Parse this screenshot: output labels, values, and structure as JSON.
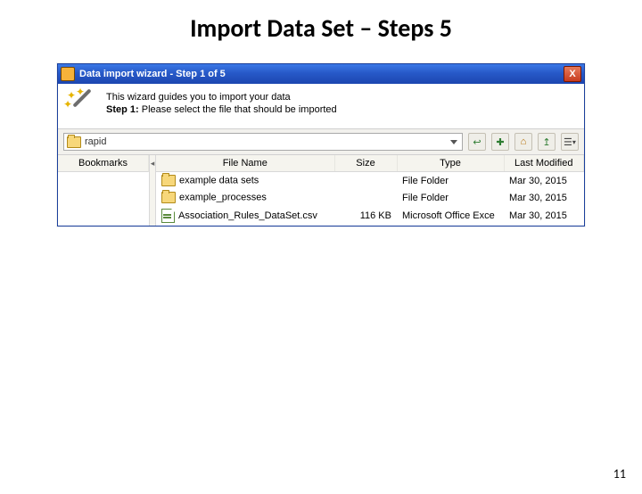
{
  "slide": {
    "title": "Import Data Set – Steps 5",
    "page_number": "11"
  },
  "window": {
    "title": "Data import wizard - Step 1 of 5",
    "wizard_intro": "This wizard guides you to import your data",
    "step_label": "Step 1:",
    "step_text": " Please select the file that should be imported",
    "path_value": "rapid",
    "toolbar_icons": [
      "back-icon",
      "new-folder-icon",
      "home-icon",
      "up-icon",
      "view-icon"
    ],
    "columns": {
      "bookmarks": "Bookmarks",
      "filename": "File Name",
      "size": "Size",
      "type": "Type",
      "modified": "Last Modified"
    },
    "rows": [
      {
        "icon": "folder",
        "name": "example data sets",
        "size": "",
        "type": "File Folder",
        "modified": "Mar 30, 2015"
      },
      {
        "icon": "folder",
        "name": "example_processes",
        "size": "",
        "type": "File Folder",
        "modified": "Mar 30, 2015"
      },
      {
        "icon": "file",
        "name": "Association_Rules_DataSet.csv",
        "size": "116 KB",
        "type": "Microsoft Office Exce",
        "modified": "Mar 30, 2015"
      }
    ]
  }
}
